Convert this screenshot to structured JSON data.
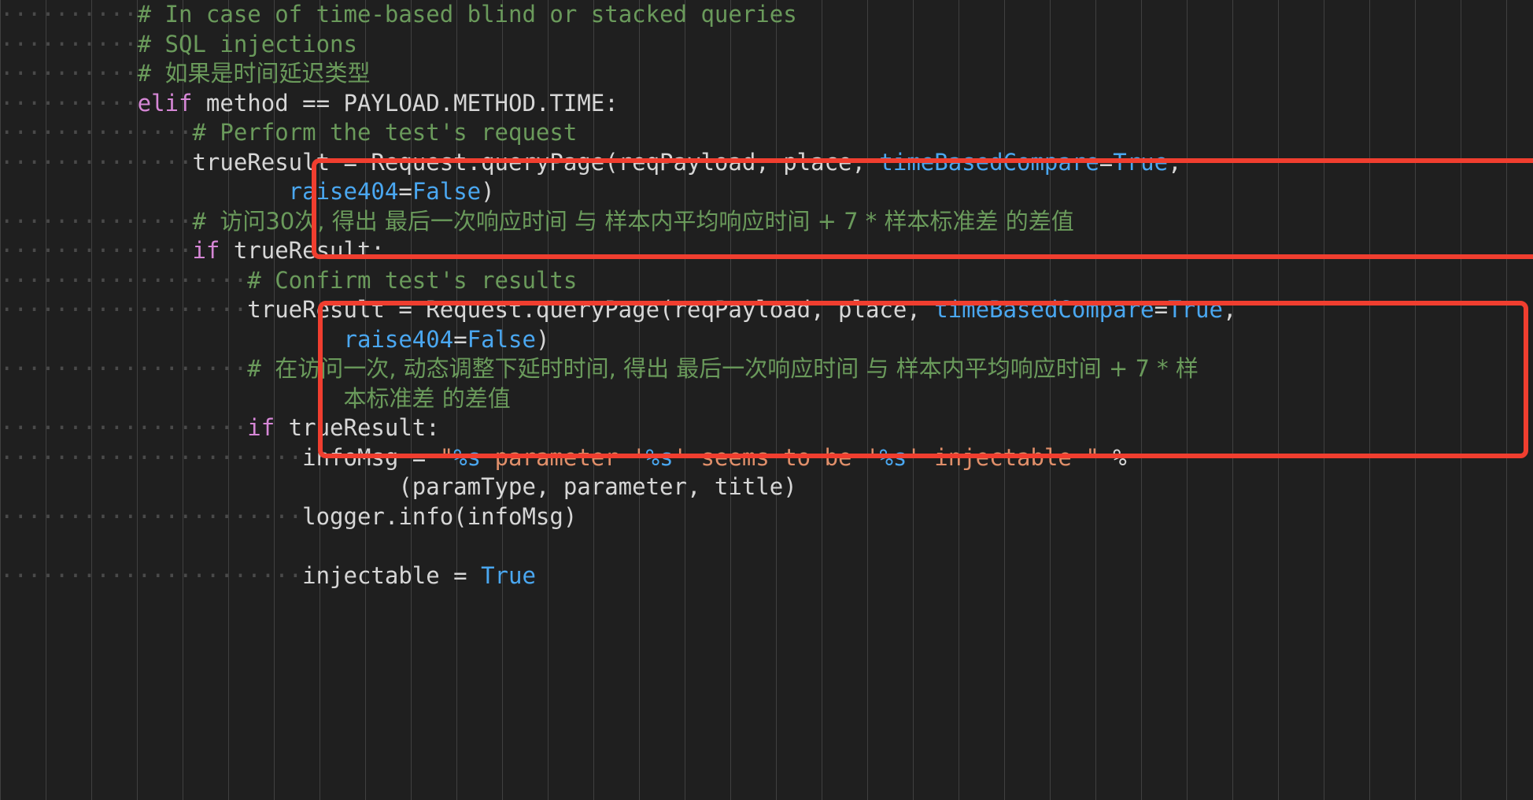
{
  "editor": {
    "language": "Python",
    "theme": "Dark Modern",
    "background_color": "#1f1f1f",
    "word_wrap": true,
    "render_whitespace": true,
    "indent_guides": true,
    "colors": {
      "comment": "#6a9a5b",
      "keyword": "#d687d6",
      "plain": "#d6d6d6",
      "constant": "#4aa7f0",
      "string": "#e08f6a",
      "format_spec": "#4aa7f0",
      "annotation_box": "#f03e2f",
      "indent_guide": "#404040",
      "whitespace_dot": "#4a4a4a"
    }
  },
  "annotations": [
    {
      "id": "annotation-box-1",
      "label": "first-highlight-box",
      "color": "#f03e2f",
      "clipped_right": true
    },
    {
      "id": "annotation-box-2",
      "label": "second-highlight-box",
      "color": "#f03e2f",
      "clipped_right": false
    }
  ],
  "lines": [
    {
      "id": "line-1",
      "indent": "··········",
      "tokens": [
        {
          "cls": "c",
          "text": "# In case of time-based blind or stacked queries"
        }
      ]
    },
    {
      "id": "line-2",
      "indent": "··········",
      "tokens": [
        {
          "cls": "c",
          "text": "# SQL injections"
        }
      ]
    },
    {
      "id": "line-3",
      "indent": "··········",
      "tokens": [
        {
          "cls": "c",
          "text": "# "
        },
        {
          "cls": "c cjk",
          "text": "如果是时间延迟类型"
        }
      ]
    },
    {
      "id": "line-4",
      "indent": "··········",
      "tokens": [
        {
          "cls": "kw",
          "text": "elif"
        },
        {
          "cls": "pl",
          "text": " method == PAYLOAD.METHOD.TIME:"
        }
      ]
    },
    {
      "id": "line-5",
      "indent": "··············",
      "tokens": [
        {
          "cls": "c",
          "text": "# Perform the test's request"
        }
      ]
    },
    {
      "id": "line-6",
      "indent": "··············",
      "tokens": [
        {
          "cls": "pl",
          "text": "trueResult = Request.queryPage(reqPayload, place, "
        },
        {
          "cls": "pm",
          "text": "timeBasedCompare"
        },
        {
          "cls": "pl",
          "text": "="
        },
        {
          "cls": "cn",
          "text": "True"
        },
        {
          "cls": "pl",
          "text": ","
        }
      ]
    },
    {
      "id": "line-7",
      "indent": "",
      "wrapped": true,
      "tokens": [
        {
          "cls": "pm",
          "text": "raise404"
        },
        {
          "cls": "pl",
          "text": "="
        },
        {
          "cls": "cn",
          "text": "False"
        },
        {
          "cls": "pl",
          "text": ")"
        }
      ]
    },
    {
      "id": "line-8",
      "indent": "··············",
      "tokens": [
        {
          "cls": "c",
          "text": "# "
        },
        {
          "cls": "c cjk",
          "text": "访问30次, 得出 最后一次响应时间 与 样本内平均响应时间 + 7 * 样本标准差 的差值"
        }
      ]
    },
    {
      "id": "line-9",
      "indent": "··············",
      "tokens": [
        {
          "cls": "kw",
          "text": "if"
        },
        {
          "cls": "pl",
          "text": " trueResult:"
        }
      ]
    },
    {
      "id": "line-10",
      "indent": "··················",
      "tokens": [
        {
          "cls": "c",
          "text": "# Confirm test's results"
        }
      ]
    },
    {
      "id": "line-11",
      "indent": "··················",
      "tokens": [
        {
          "cls": "pl",
          "text": "trueResult = Request.queryPage(reqPayload, place, "
        },
        {
          "cls": "pm",
          "text": "timeBasedCompare"
        },
        {
          "cls": "pl",
          "text": "="
        },
        {
          "cls": "cn",
          "text": "True"
        },
        {
          "cls": "pl",
          "text": ","
        }
      ]
    },
    {
      "id": "line-12",
      "indent": "",
      "wrapped": true,
      "tokens": [
        {
          "cls": "pm",
          "text": "raise404"
        },
        {
          "cls": "pl",
          "text": "="
        },
        {
          "cls": "cn",
          "text": "False"
        },
        {
          "cls": "pl",
          "text": ")"
        }
      ]
    },
    {
      "id": "line-13",
      "indent": "··················",
      "tokens": [
        {
          "cls": "c",
          "text": "# "
        },
        {
          "cls": "c cjk",
          "text": "在访问一次, 动态调整下延时时间, 得出 最后一次响应时间 与 样本内平均响应时间 + 7 * 样"
        }
      ]
    },
    {
      "id": "line-14",
      "indent": "",
      "wrapped": true,
      "tokens": [
        {
          "cls": "c cjk",
          "text": "本标准差 的差值"
        }
      ]
    },
    {
      "id": "line-15",
      "indent": "··················",
      "tokens": [
        {
          "cls": "kw",
          "text": "if"
        },
        {
          "cls": "pl",
          "text": " trueResult:"
        }
      ]
    },
    {
      "id": "line-16",
      "indent": "······················",
      "tokens": [
        {
          "cls": "pl",
          "text": "infoMsg = "
        },
        {
          "cls": "st",
          "text": "\""
        },
        {
          "cls": "fm",
          "text": "%s"
        },
        {
          "cls": "st",
          "text": " parameter '"
        },
        {
          "cls": "fm",
          "text": "%s"
        },
        {
          "cls": "st",
          "text": "' seems to be '"
        },
        {
          "cls": "fm",
          "text": "%s"
        },
        {
          "cls": "st",
          "text": "' injectable \""
        },
        {
          "cls": "pl",
          "text": " %"
        }
      ]
    },
    {
      "id": "line-17",
      "indent": "",
      "wrapped": true,
      "tokens": [
        {
          "cls": "pl",
          "text": "(paramType, parameter, title)"
        }
      ]
    },
    {
      "id": "line-18",
      "indent": "······················",
      "tokens": [
        {
          "cls": "pl",
          "text": "logger.info(infoMsg)"
        }
      ]
    },
    {
      "id": "line-19",
      "indent": "",
      "tokens": []
    },
    {
      "id": "line-20",
      "indent": "······················",
      "tokens": [
        {
          "cls": "pl",
          "text": "injectable = "
        },
        {
          "cls": "cn",
          "text": "True"
        }
      ]
    }
  ]
}
